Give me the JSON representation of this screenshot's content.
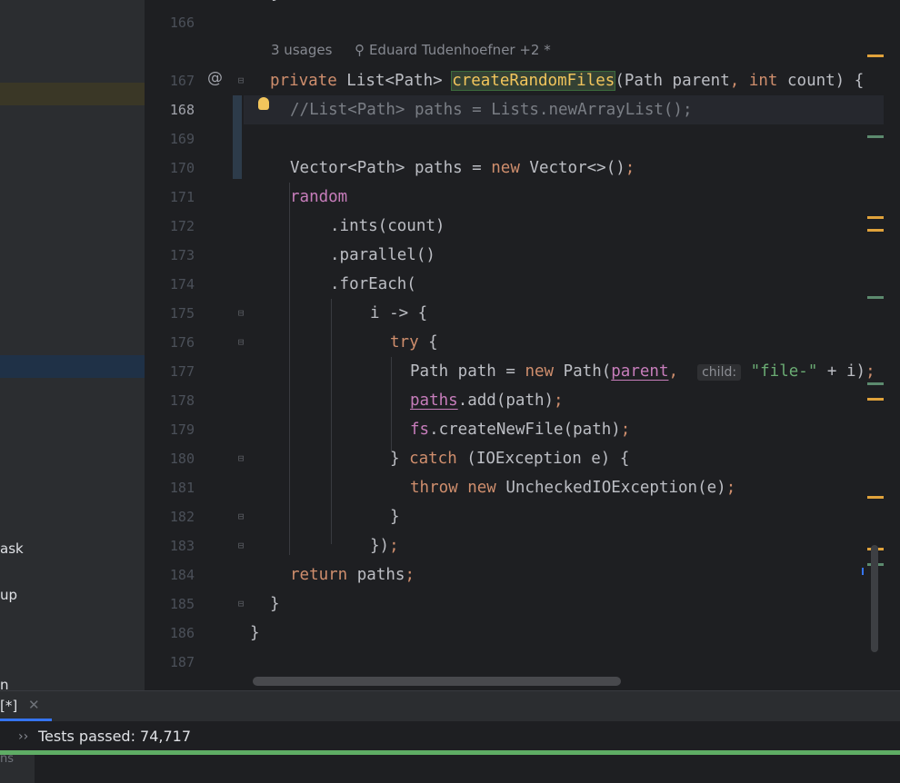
{
  "sidebar": {
    "items": [
      {
        "label": "ask"
      },
      {
        "label": "up"
      },
      {
        "label": "n"
      }
    ]
  },
  "editor": {
    "usages_hint": "3 usages",
    "author_hint": "Eduard Tudenhoefner +2 *",
    "inlay_child": "child:",
    "line_numbers": [
      "166",
      "167",
      "168",
      "169",
      "170",
      "171",
      "172",
      "173",
      "174",
      "175",
      "176",
      "177",
      "178",
      "179",
      "180",
      "181",
      "182",
      "183",
      "184",
      "185",
      "186",
      "187"
    ],
    "current_line": "168"
  },
  "bottom_tool": {
    "tab_label": "[*]",
    "status_text": "Tests passed: 74,717",
    "side_text": "ns"
  },
  "colors": {
    "keyword": "#cf8e6d",
    "string": "#6aab73",
    "comment": "#7a7e85",
    "field": "#c77dbb",
    "progress": "#5fad65",
    "warning_mark": "#e0a23b",
    "change_mark": "#5c8a6e"
  },
  "icons": {
    "annotation": "at-icon",
    "intention": "bulb-icon",
    "fold": "fold-icon",
    "close": "close-icon",
    "chevron": "chevron-right-icon",
    "author": "person-icon"
  }
}
